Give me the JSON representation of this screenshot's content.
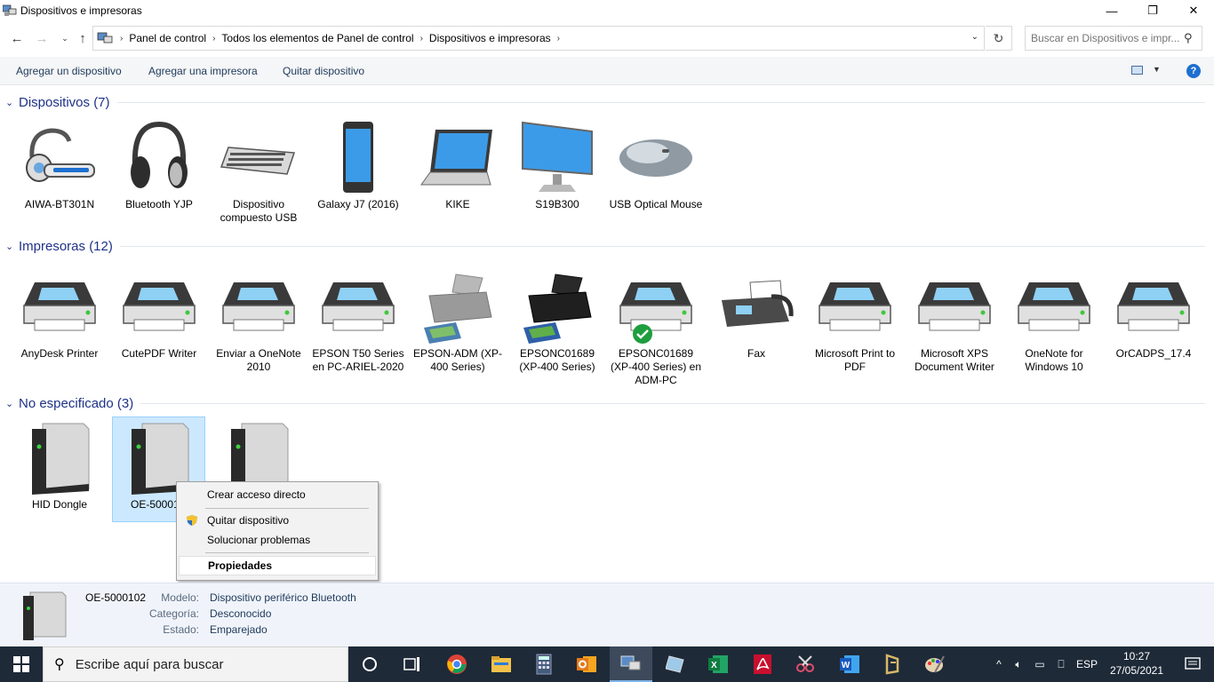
{
  "window": {
    "title": "Dispositivos e impresoras",
    "minimize": "—",
    "restore": "❐",
    "close": "✕"
  },
  "address": {
    "breadcrumbs": [
      "Panel de control",
      "Todos los elementos de Panel de control",
      "Dispositivos e impresoras"
    ],
    "search_placeholder": "Buscar en Dispositivos e impr..."
  },
  "toolbar": {
    "add_device": "Agregar un dispositivo",
    "add_printer": "Agregar una impresora",
    "remove_device": "Quitar dispositivo",
    "help": "?"
  },
  "groups": {
    "devices": {
      "title": "Dispositivos (7)",
      "items": [
        {
          "label": "AIWA-BT301N",
          "icon": "headset-icon"
        },
        {
          "label": "Bluetooth  YJP",
          "icon": "headphones-icon"
        },
        {
          "label": "Dispositivo compuesto USB",
          "icon": "keyboard-icon"
        },
        {
          "label": "Galaxy J7 (2016)",
          "icon": "phone-icon"
        },
        {
          "label": "KIKE",
          "icon": "laptop-icon"
        },
        {
          "label": "S19B300",
          "icon": "monitor-icon"
        },
        {
          "label": "USB Optical Mouse",
          "icon": "mouse-icon"
        }
      ]
    },
    "printers": {
      "title": "Impresoras (12)",
      "items": [
        {
          "label": "AnyDesk Printer",
          "icon": "printer-icon"
        },
        {
          "label": "CutePDF Writer",
          "icon": "printer-icon"
        },
        {
          "label": "Enviar a OneNote 2010",
          "icon": "printer-icon"
        },
        {
          "label": "EPSON T50 Series en PC-ARIEL-2020",
          "icon": "printer-icon"
        },
        {
          "label": "EPSON-ADM (XP-400 Series)",
          "icon": "inkjet-gray-icon"
        },
        {
          "label": "EPSONC01689 (XP-400 Series)",
          "icon": "inkjet-black-icon"
        },
        {
          "label": "EPSONC01689 (XP-400 Series) en ADM-PC",
          "icon": "printer-default-icon"
        },
        {
          "label": "Fax",
          "icon": "fax-icon"
        },
        {
          "label": "Microsoft Print to PDF",
          "icon": "printer-icon"
        },
        {
          "label": "Microsoft XPS Document Writer",
          "icon": "printer-icon"
        },
        {
          "label": "OneNote for Windows 10",
          "icon": "printer-icon"
        },
        {
          "label": "OrCADPS_17.4",
          "icon": "printer-icon"
        }
      ]
    },
    "unspecified": {
      "title": "No especificado (3)",
      "items": [
        {
          "label": "HID Dongle",
          "icon": "generic-device-icon"
        },
        {
          "label": "OE-50001",
          "icon": "generic-device-icon",
          "selected": true
        },
        {
          "label": "",
          "icon": "generic-device-icon"
        }
      ]
    }
  },
  "context_menu": {
    "create_shortcut": "Crear acceso directo",
    "remove_device": "Quitar dispositivo",
    "troubleshoot": "Solucionar problemas",
    "properties": "Propiedades"
  },
  "details": {
    "name": "OE-5000102",
    "model_key": "Modelo:",
    "model_val": "Dispositivo periférico Bluetooth",
    "category_key": "Categoría:",
    "category_val": "Desconocido",
    "status_key": "Estado:",
    "status_val": "Emparejado"
  },
  "taskbar": {
    "search_placeholder": "Escribe aquí para buscar",
    "language": "ESP",
    "time": "10:27",
    "date": "27/05/2021"
  }
}
